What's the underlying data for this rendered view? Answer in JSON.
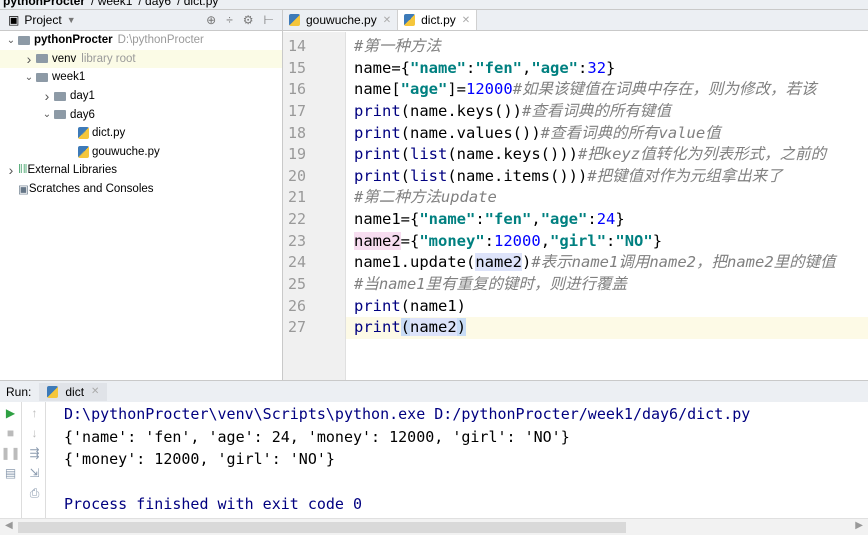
{
  "breadcrumb": [
    "pythonProcter",
    "week1",
    "day6",
    "dict.py"
  ],
  "project": {
    "label": "Project",
    "tree": [
      {
        "name": "pythonProcter",
        "hint": "D:\\pythonProcter",
        "depth": 0,
        "arrow": "v",
        "type": "folder",
        "bold": true
      },
      {
        "name": "venv",
        "hint": "library root",
        "depth": 1,
        "arrow": ">",
        "type": "folder",
        "highlight": true
      },
      {
        "name": "week1",
        "hint": "",
        "depth": 1,
        "arrow": "v",
        "type": "folder"
      },
      {
        "name": "day1",
        "hint": "",
        "depth": 2,
        "arrow": ">",
        "type": "folder"
      },
      {
        "name": "day6",
        "hint": "",
        "depth": 2,
        "arrow": "v",
        "type": "folder"
      },
      {
        "name": "dict.py",
        "hint": "",
        "depth": 3,
        "arrow": "",
        "type": "py"
      },
      {
        "name": "gouwuche.py",
        "hint": "",
        "depth": 3,
        "arrow": "",
        "type": "py"
      },
      {
        "name": "External Libraries",
        "hint": "",
        "depth": 0,
        "arrow": ">",
        "type": "lib"
      },
      {
        "name": "Scratches and Consoles",
        "hint": "",
        "depth": 0,
        "arrow": "",
        "type": "scratch"
      }
    ]
  },
  "tabs": [
    {
      "label": "gouwuche.py",
      "active": false
    },
    {
      "label": "dict.py",
      "active": true
    }
  ],
  "code": [
    {
      "n": "14",
      "t": [
        [
          "cm",
          "#第一种方法"
        ]
      ]
    },
    {
      "n": "15",
      "t": [
        [
          "pl",
          "name={"
        ],
        [
          "str",
          "\"name\""
        ],
        [
          "pl",
          ":"
        ],
        [
          "str",
          "\"fen\""
        ],
        [
          "pl",
          ","
        ],
        [
          "str",
          "\"age\""
        ],
        [
          "pl",
          ":"
        ],
        [
          "num",
          "32"
        ],
        [
          "pl",
          "}"
        ]
      ]
    },
    {
      "n": "16",
      "t": [
        [
          "pl",
          "name["
        ],
        [
          "str",
          "\"age\""
        ],
        [
          "pl",
          "]="
        ],
        [
          "num",
          "12000"
        ],
        [
          "cm",
          "#如果该键值在词典中存在，则为修改，若该"
        ]
      ]
    },
    {
      "n": "17",
      "t": [
        [
          "kw",
          "print"
        ],
        [
          "pl",
          "(name.keys())"
        ],
        [
          "cm",
          "#查看词典的所有键值"
        ]
      ]
    },
    {
      "n": "18",
      "t": [
        [
          "kw",
          "print"
        ],
        [
          "pl",
          "(name.values())"
        ],
        [
          "cm",
          "#查看词典的所有value值"
        ]
      ]
    },
    {
      "n": "19",
      "t": [
        [
          "kw",
          "print"
        ],
        [
          "pl",
          "("
        ],
        [
          "kw",
          "list"
        ],
        [
          "pl",
          "(name.keys()))"
        ],
        [
          "cm",
          "#把keyz值转化为列表形式，之前的"
        ]
      ]
    },
    {
      "n": "20",
      "t": [
        [
          "kw",
          "print"
        ],
        [
          "pl",
          "("
        ],
        [
          "kw",
          "list"
        ],
        [
          "pl",
          "(name.items()))"
        ],
        [
          "cm",
          "#把键值对作为元组拿出来了"
        ]
      ]
    },
    {
      "n": "21",
      "t": [
        [
          "cm",
          "#第二种方法update"
        ]
      ]
    },
    {
      "n": "22",
      "t": [
        [
          "pl",
          "name1={"
        ],
        [
          "str",
          "\"name\""
        ],
        [
          "pl",
          ":"
        ],
        [
          "str",
          "\"fen\""
        ],
        [
          "pl",
          ","
        ],
        [
          "str",
          "\"age\""
        ],
        [
          "pl",
          ":"
        ],
        [
          "num",
          "24"
        ],
        [
          "pl",
          "}"
        ]
      ]
    },
    {
      "n": "23",
      "t": [
        [
          "pl hlv",
          "name2"
        ],
        [
          "pl",
          "={"
        ],
        [
          "str",
          "\"money\""
        ],
        [
          "pl",
          ":"
        ],
        [
          "num",
          "12000"
        ],
        [
          "pl",
          ","
        ],
        [
          "str",
          "\"girl\""
        ],
        [
          "pl",
          ":"
        ],
        [
          "str",
          "\"NO\""
        ],
        [
          "pl",
          "}"
        ]
      ]
    },
    {
      "n": "24",
      "t": [
        [
          "pl",
          "name1.update("
        ],
        [
          "pl hlr",
          "name2"
        ],
        [
          "pl",
          ")"
        ],
        [
          "cm",
          "#表示name1调用name2，把name2里的键值"
        ]
      ]
    },
    {
      "n": "25",
      "t": [
        [
          "cm",
          "#当name1里有重复的键时，则进行覆盖"
        ]
      ]
    },
    {
      "n": "26",
      "t": [
        [
          "kw",
          "print"
        ],
        [
          "pl",
          "(name1)"
        ]
      ]
    },
    {
      "n": "27",
      "t": [
        [
          "kw",
          "print"
        ],
        [
          "pl hlb",
          "("
        ],
        [
          "pl hlr",
          "name2"
        ],
        [
          "pl hlb",
          ")"
        ]
      ],
      "current": true
    }
  ],
  "run": {
    "label": "Run:",
    "tab": "dict",
    "output": [
      {
        "text": "D:\\pythonProcter\\venv\\Scripts\\python.exe D:/pythonProcter/week1/day6/dict.py",
        "blue": true
      },
      {
        "text": "{'name': 'fen', 'age': 24, 'money': 12000, 'girl': 'NO'}",
        "blue": false
      },
      {
        "text": "{'money': 12000, 'girl': 'NO'}",
        "blue": false
      },
      {
        "text": "",
        "blue": false
      },
      {
        "text": "Process finished with exit code 0",
        "blue": true
      }
    ]
  },
  "scroll": {
    "horizontal_fraction": 0.7
  }
}
